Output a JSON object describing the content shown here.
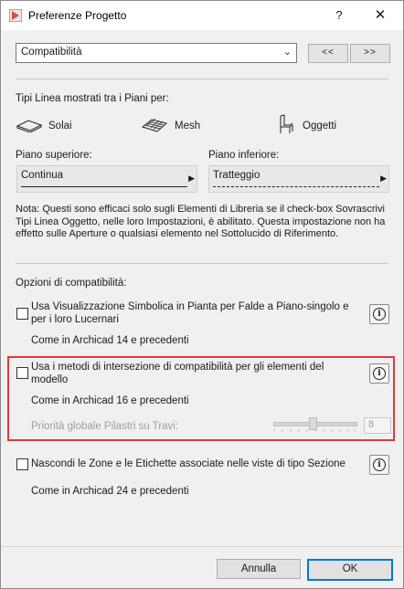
{
  "window": {
    "title": "Preferenze Progetto",
    "help_glyph": "?",
    "close_glyph": "✕"
  },
  "topbar": {
    "dropdown_value": "Compatibilità",
    "prev_label": "<<",
    "next_label": ">>"
  },
  "linetypes": {
    "heading": "Tipi Linea mostrati tra i Piani per:",
    "items": [
      {
        "label": "Solai",
        "icon": "slab-icon"
      },
      {
        "label": "Mesh",
        "icon": "mesh-icon"
      },
      {
        "label": "Oggetti",
        "icon": "chair-object-icon"
      }
    ]
  },
  "floors": {
    "upper_label": "Piano superiore:",
    "upper_value": "Continua",
    "lower_label": "Piano inferiore:",
    "lower_value": "Tratteggio"
  },
  "note": "Nota: Questi sono efficaci solo sugli Elementi di Libreria se il check-box Sovrascrivi Tipi Linea Oggetto, nelle loro Impostazioni, è abilitato. Questa impostazione non ha effetto sulle Aperture o qualsiasi elemento nel Sottolucido di Riferimento.",
  "compat": {
    "heading": "Opzioni di compatibilità:",
    "opt1": {
      "line1": "Usa Visualizzazione Simbolica in Pianta per Falde a Piano-singolo e",
      "line2": "per i loro Lucernari",
      "sub": "Come in Archicad 14 e precedenti",
      "checked": false
    },
    "opt2": {
      "line1": "Usa i metodi di intersezione di compatibilità per gli elementi del",
      "line2": "modello",
      "sub": "Come in Archicad 16 e precedenti",
      "checked": false,
      "priority_label": "Priorità globale Pilastri su Travi:",
      "priority_value": "8"
    },
    "opt3": {
      "line1": "Nascondi le Zone e le Etichette associate nelle viste di tipo Sezione",
      "sub": "Come in Archicad 24 e precedenti",
      "checked": false
    }
  },
  "footer": {
    "cancel_label": "Annulla",
    "ok_label": "OK"
  },
  "colors": {
    "highlight": "#e53935",
    "ok_border": "#0078d7"
  }
}
